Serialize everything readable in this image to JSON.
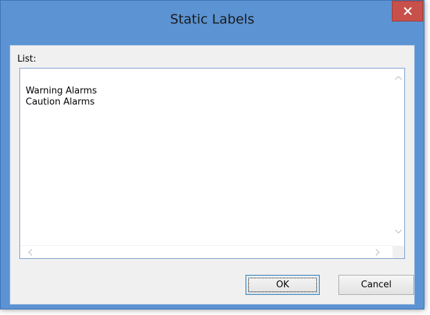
{
  "window": {
    "title": "Static Labels",
    "close_icon": "close-icon"
  },
  "list": {
    "label": "List:",
    "items": [
      "Warning Alarms",
      "Caution Alarms"
    ]
  },
  "scrollbars": {
    "up_icon": "chevron-up-icon",
    "down_icon": "chevron-down-icon",
    "left_icon": "chevron-left-icon",
    "right_icon": "chevron-right-icon"
  },
  "buttons": {
    "ok_label": "OK",
    "cancel_label": "Cancel"
  },
  "colors": {
    "titlebar": "#5b93d3",
    "close_button": "#c7504a",
    "client_background": "#f0f0f0",
    "listbox_border": "#7a9fd0"
  }
}
